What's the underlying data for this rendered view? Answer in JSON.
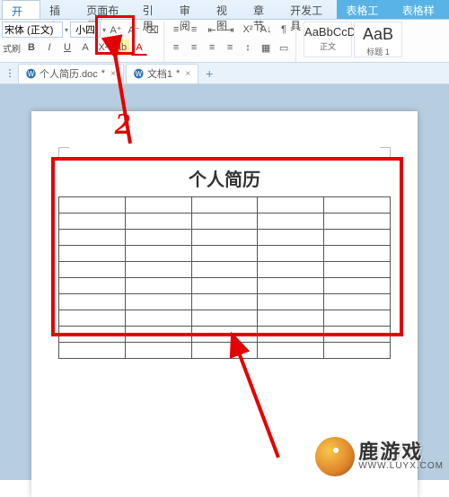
{
  "tabs": {
    "items": [
      {
        "label": "开始",
        "active": true
      },
      {
        "label": "插入",
        "active": false
      },
      {
        "label": "页面布局",
        "active": false
      },
      {
        "label": "引用",
        "active": false
      },
      {
        "label": "审阅",
        "active": false
      },
      {
        "label": "视图",
        "active": false
      },
      {
        "label": "章节",
        "active": false
      },
      {
        "label": "开发工具",
        "active": false
      },
      {
        "label": "表格工具",
        "active": false,
        "context": true
      },
      {
        "label": "表格样式",
        "active": false,
        "context": true
      }
    ]
  },
  "ribbon": {
    "font_name": "宋体 (正文)",
    "font_size": "小四",
    "btn_cut": "式刷",
    "btn_bold": "B",
    "btn_italic": "I",
    "btn_underline": "U",
    "btn_strike": "A",
    "btn_sup": "X²",
    "btn_grow": "A⁺",
    "btn_shrink": "A⁻",
    "btn_clear": "⌫",
    "btn_highlight": "ab",
    "btn_color": "A",
    "btn_bullets": "≡",
    "btn_numbers": "≡",
    "btn_indent_dec": "⇤",
    "btn_indent_inc": "⇥",
    "btn_align_l": "≡",
    "btn_align_c": "≡",
    "btn_align_r": "≡",
    "btn_align_j": "≡",
    "btn_linespace": "↕",
    "btn_shade": "▦",
    "btn_border": "▭",
    "btn_para": "¶",
    "styles": [
      {
        "preview": "AaBbCcDd",
        "label": "正文"
      },
      {
        "preview": "AaB",
        "label": "标题 1"
      }
    ]
  },
  "doctabs": {
    "items": [
      {
        "label": "个人简历.doc",
        "star": "*"
      },
      {
        "label": "文档1",
        "star": "*"
      }
    ],
    "add": "+"
  },
  "document": {
    "title": "个人简历",
    "table": {
      "rows": 10,
      "cols": 5
    }
  },
  "annotations": {
    "step_label": "2",
    "colors": {
      "highlight": "#e40000"
    }
  },
  "watermark": {
    "cn": "鹿游戏",
    "url": "WWW.LUYX.COM"
  }
}
